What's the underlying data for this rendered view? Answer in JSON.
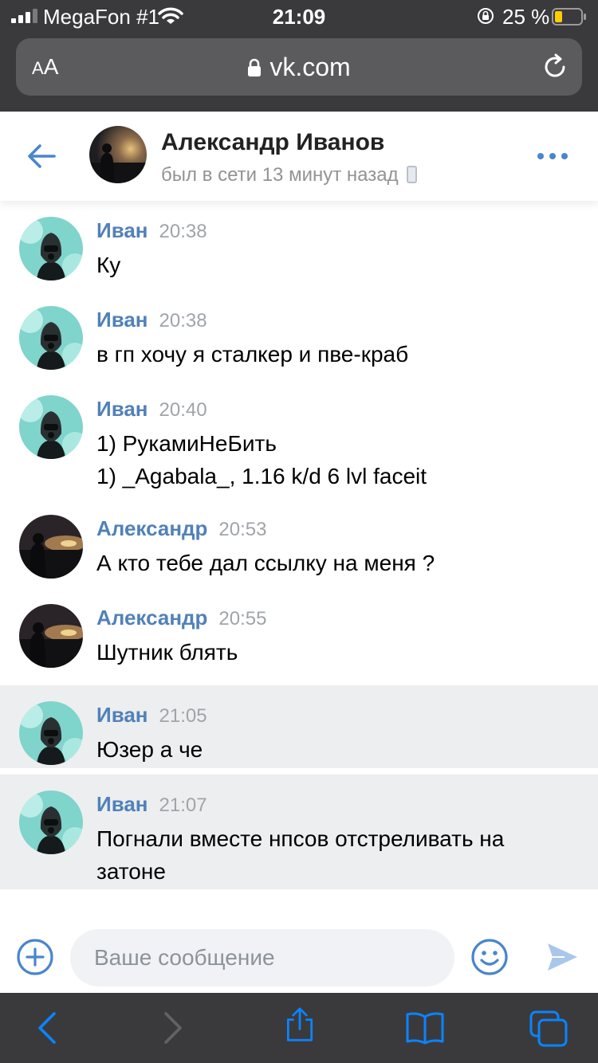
{
  "status_bar": {
    "carrier": "MegaFon #1",
    "time": "21:09",
    "battery_percent": "25 %"
  },
  "browser": {
    "text_size_label_small": "A",
    "text_size_label_large": "A",
    "url": "vk.com"
  },
  "chat_header": {
    "name": "Александр Иванов",
    "status": "был в сети 13 минут назад"
  },
  "messages": [
    {
      "author": "Иван",
      "time": "20:38",
      "lines": [
        "Ку"
      ]
    },
    {
      "author": "Иван",
      "time": "20:38",
      "lines": [
        "в гп хочу я сталкер и пве-краб"
      ]
    },
    {
      "author": "Иван",
      "time": "20:40",
      "lines": [
        "1) РукамиНеБить",
        "1) _Agabala_, 1.16 k/d 6 lvl faceit"
      ]
    },
    {
      "author": "Александр",
      "time": "20:53",
      "lines": [
        "А кто тебе дал ссылку на меня ?"
      ]
    },
    {
      "author": "Александр",
      "time": "20:55",
      "lines": [
        "Шутник блять"
      ]
    },
    {
      "author": "Иван",
      "time": "21:05",
      "lines": [
        "Юзер а че"
      ],
      "unread": true
    },
    {
      "author": "Иван",
      "time": "21:07",
      "lines": [
        "Погнали вместе нпсов отстреливать на",
        "затоне"
      ],
      "unread": true
    }
  ],
  "composer": {
    "placeholder": "Ваше сообщение"
  },
  "colors": {
    "accent": "#5181b8",
    "icon_blue": "#4986cc",
    "unread_background": "#edeef0",
    "browser_chrome": "#3a3a3c",
    "safari_blue": "#0a84ff"
  },
  "icons": {
    "status": [
      "signal-icon",
      "wifi-icon",
      "rotation-lock-icon",
      "battery-icon"
    ],
    "browser": [
      "padlock-icon",
      "reload-icon"
    ],
    "header": [
      "back-arrow-icon",
      "more-icon",
      "mobile-phone-icon"
    ],
    "composer": [
      "attach-plus-icon",
      "emoji-icon",
      "send-icon"
    ],
    "toolbar": [
      "back-icon",
      "forward-icon",
      "share-icon",
      "bookmarks-icon",
      "tabs-icon"
    ]
  }
}
